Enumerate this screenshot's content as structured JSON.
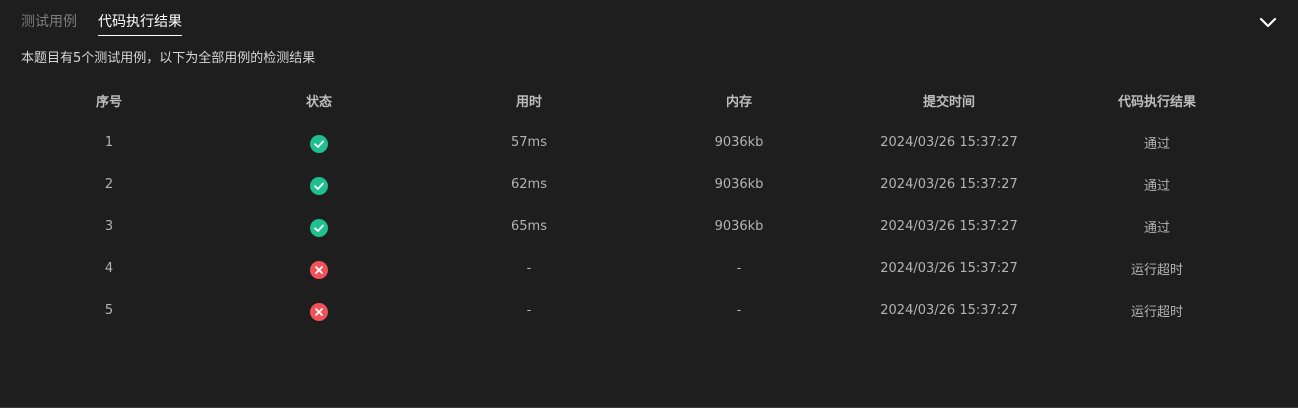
{
  "tabs": [
    {
      "label": "测试用例",
      "active": false
    },
    {
      "label": "代码执行结果",
      "active": true
    }
  ],
  "summary": "本题目有5个测试用例，以下为全部用例的检测结果",
  "table": {
    "headers": [
      "序号",
      "状态",
      "用时",
      "内存",
      "提交时间",
      "代码执行结果"
    ],
    "rows": [
      {
        "index": "1",
        "status": "pass",
        "time": "57ms",
        "memory": "9036kb",
        "submitted": "2024/03/26 15:37:27",
        "result": "通过"
      },
      {
        "index": "2",
        "status": "pass",
        "time": "62ms",
        "memory": "9036kb",
        "submitted": "2024/03/26 15:37:27",
        "result": "通过"
      },
      {
        "index": "3",
        "status": "pass",
        "time": "65ms",
        "memory": "9036kb",
        "submitted": "2024/03/26 15:37:27",
        "result": "通过"
      },
      {
        "index": "4",
        "status": "fail",
        "time": "-",
        "memory": "-",
        "submitted": "2024/03/26 15:37:27",
        "result": "运行超时"
      },
      {
        "index": "5",
        "status": "fail",
        "time": "-",
        "memory": "-",
        "submitted": "2024/03/26 15:37:27",
        "result": "运行超时"
      }
    ]
  },
  "colors": {
    "pass": "#1fbf8f",
    "fail": "#f0525a"
  },
  "icons": {
    "collapse": "chevron-down-icon",
    "pass": "check-circle-icon",
    "fail": "x-circle-icon"
  }
}
